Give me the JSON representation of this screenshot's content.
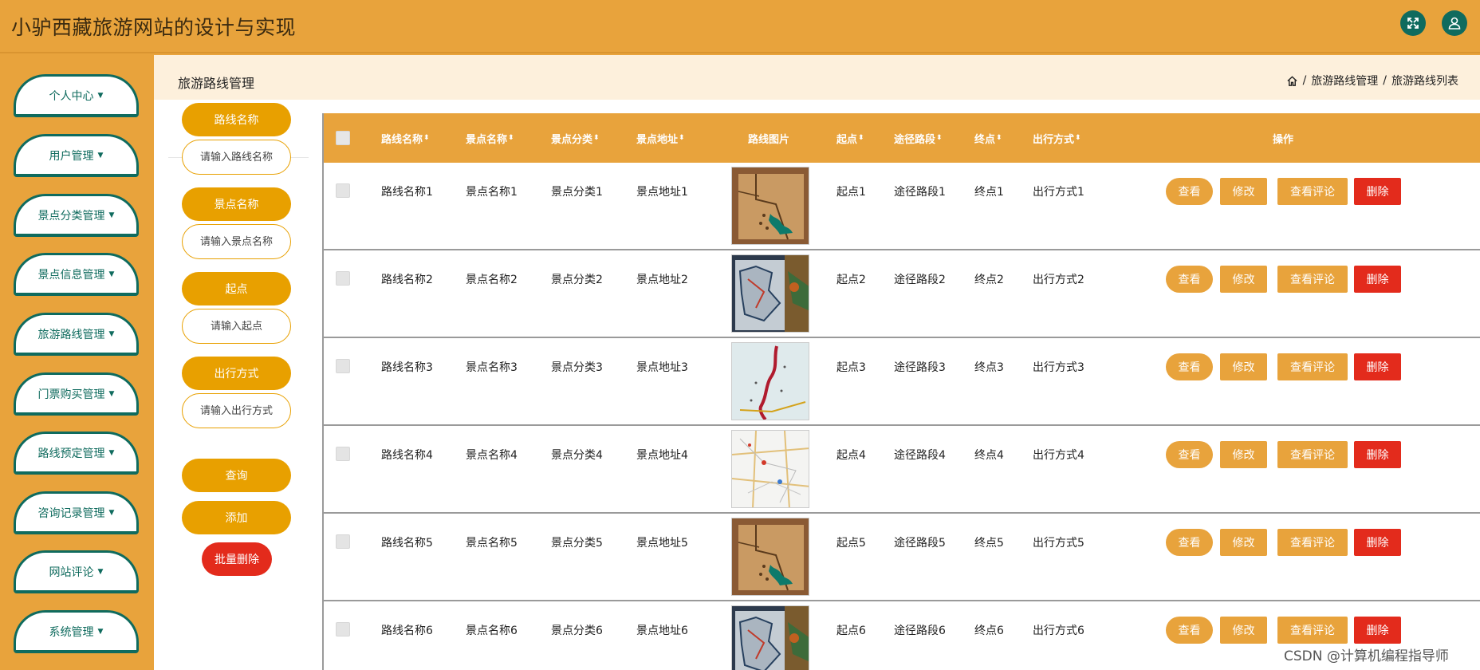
{
  "app": {
    "title": "小驴西藏旅游网站的设计与实现"
  },
  "header": {
    "icons": [
      "fullscreen-icon",
      "user-icon"
    ],
    "accent_color": "#e8a33c",
    "dark_color": "#0f6b5e"
  },
  "sidebar": {
    "items": [
      {
        "label": "个人中心"
      },
      {
        "label": "用户管理"
      },
      {
        "label": "景点分类管理"
      },
      {
        "label": "景点信息管理"
      },
      {
        "label": "旅游路线管理"
      },
      {
        "label": "门票购买管理"
      },
      {
        "label": "路线预定管理"
      },
      {
        "label": "咨询记录管理"
      },
      {
        "label": "网站评论"
      },
      {
        "label": "系统管理"
      }
    ]
  },
  "page": {
    "title": "旅游路线管理",
    "breadcrumb": [
      "旅游路线管理",
      "旅游路线列表"
    ],
    "separator": "/"
  },
  "filters": {
    "route_name_label": "路线名称",
    "route_name_placeholder": "请输入路线名称",
    "spot_name_label": "景点名称",
    "spot_name_placeholder": "请输入景点名称",
    "start_label": "起点",
    "start_placeholder": "请输入起点",
    "travel_mode_label": "出行方式",
    "travel_mode_placeholder": "请输入出行方式",
    "search_label": "查询",
    "add_label": "添加",
    "batch_delete_label": "批量删除"
  },
  "table": {
    "columns": [
      "路线名称",
      "景点名称",
      "景点分类",
      "景点地址",
      "路线图片",
      "起点",
      "途径路段",
      "终点",
      "出行方式",
      "操作"
    ],
    "sort_glyph": "⬍",
    "actions": {
      "view": "查看",
      "edit": "修改",
      "comment": "查看评论",
      "delete": "删除"
    },
    "rows": [
      {
        "route": "路线名称1",
        "spot": "景点名称1",
        "category": "景点分类1",
        "address": "景点地址1",
        "image": "map-parchment",
        "start": "起点1",
        "via": "途径路段1",
        "end": "终点1",
        "mode": "出行方式1"
      },
      {
        "route": "路线名称2",
        "spot": "景点名称2",
        "category": "景点分类2",
        "address": "景点地址2",
        "image": "map-blue",
        "start": "起点2",
        "via": "途径路段2",
        "end": "终点2",
        "mode": "出行方式2"
      },
      {
        "route": "路线名称3",
        "spot": "景点名称3",
        "category": "景点分类3",
        "address": "景点地址3",
        "image": "map-route",
        "start": "起点3",
        "via": "途径路段3",
        "end": "终点3",
        "mode": "出行方式3"
      },
      {
        "route": "路线名称4",
        "spot": "景点名称4",
        "category": "景点分类4",
        "address": "景点地址4",
        "image": "map-street",
        "start": "起点4",
        "via": "途径路段4",
        "end": "终点4",
        "mode": "出行方式4"
      },
      {
        "route": "路线名称5",
        "spot": "景点名称5",
        "category": "景点分类5",
        "address": "景点地址5",
        "image": "map-parchment",
        "start": "起点5",
        "via": "途径路段5",
        "end": "终点5",
        "mode": "出行方式5"
      },
      {
        "route": "路线名称6",
        "spot": "景点名称6",
        "category": "景点分类6",
        "address": "景点地址6",
        "image": "map-blue",
        "start": "起点6",
        "via": "途径路段6",
        "end": "终点6",
        "mode": "出行方式6"
      }
    ]
  },
  "watermark": "CSDN @计算机编程指导师"
}
